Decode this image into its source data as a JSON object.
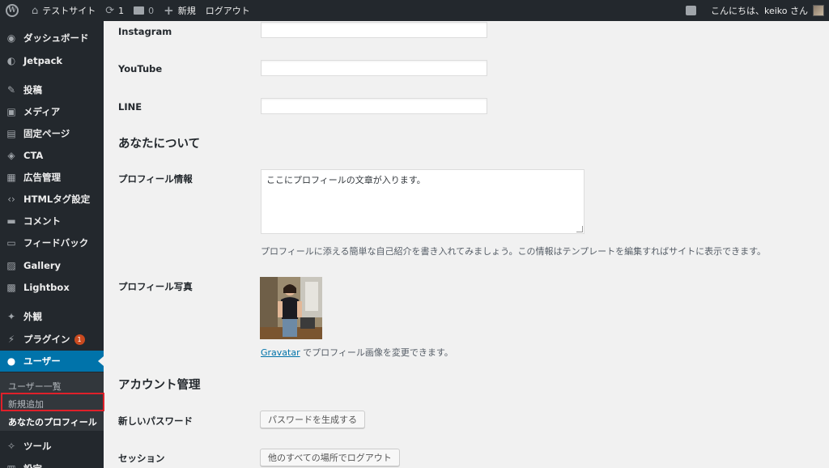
{
  "adminbar": {
    "site_name": "テストサイト",
    "updates_count": "1",
    "comments_count": "0",
    "new_label": "新規",
    "logout_label": "ログアウト",
    "greeting": "こんにちは、keiko さん"
  },
  "sidebar": {
    "items": [
      {
        "label": "ダッシュボード",
        "icon": "dashboard-icon",
        "glyph": "◉"
      },
      {
        "label": "Jetpack",
        "icon": "jetpack-icon",
        "glyph": "◐"
      },
      {
        "label": "投稿",
        "icon": "post-icon",
        "glyph": "✎"
      },
      {
        "label": "メディア",
        "icon": "media-icon",
        "glyph": "▣"
      },
      {
        "label": "固定ページ",
        "icon": "page-icon",
        "glyph": "▤"
      },
      {
        "label": "CTA",
        "icon": "cta-icon",
        "glyph": "◈"
      },
      {
        "label": "広告管理",
        "icon": "ads-icon",
        "glyph": "▦"
      },
      {
        "label": "HTMLタグ設定",
        "icon": "code-icon",
        "glyph": "‹›"
      },
      {
        "label": "コメント",
        "icon": "comment-icon",
        "glyph": "▬"
      },
      {
        "label": "フィードバック",
        "icon": "feedback-icon",
        "glyph": "▭"
      },
      {
        "label": "Gallery",
        "icon": "gallery-icon",
        "glyph": "▨"
      },
      {
        "label": "Lightbox",
        "icon": "lightbox-icon",
        "glyph": "▩"
      },
      {
        "label": "外観",
        "icon": "appearance-icon",
        "glyph": "✦"
      },
      {
        "label": "プラグイン",
        "icon": "plugin-icon",
        "glyph": "⚡",
        "badge": "1"
      },
      {
        "label": "ユーザー",
        "icon": "users-icon",
        "glyph": "●"
      },
      {
        "label": "ツール",
        "icon": "tools-icon",
        "glyph": "✧"
      },
      {
        "label": "設定",
        "icon": "settings-icon",
        "glyph": "▥"
      }
    ],
    "submenu": [
      "ユーザー一覧",
      "新規追加",
      "あなたのプロフィール"
    ]
  },
  "main": {
    "instagram_label": "Instagram",
    "youtube_label": "YouTube",
    "line_label": "LINE",
    "about_title": "あなたについて",
    "profile_info_label": "プロフィール情報",
    "profile_info_value": "ここにプロフィールの文章が入ります。",
    "profile_info_desc": "プロフィールに添える簡単な自己紹介を書き入れてみましょう。この情報はテンプレートを編集すればサイトに表示できます。",
    "profile_photo_label": "プロフィール写真",
    "gravatar_link": "Gravatar",
    "gravatar_desc": " でプロフィール画像を変更できます。",
    "account_title": "アカウント管理",
    "new_password_label": "新しいパスワード",
    "generate_password_button": "パスワードを生成する",
    "sessions_label": "セッション",
    "logout_everywhere_button": "他のすべての場所でログアウト"
  }
}
